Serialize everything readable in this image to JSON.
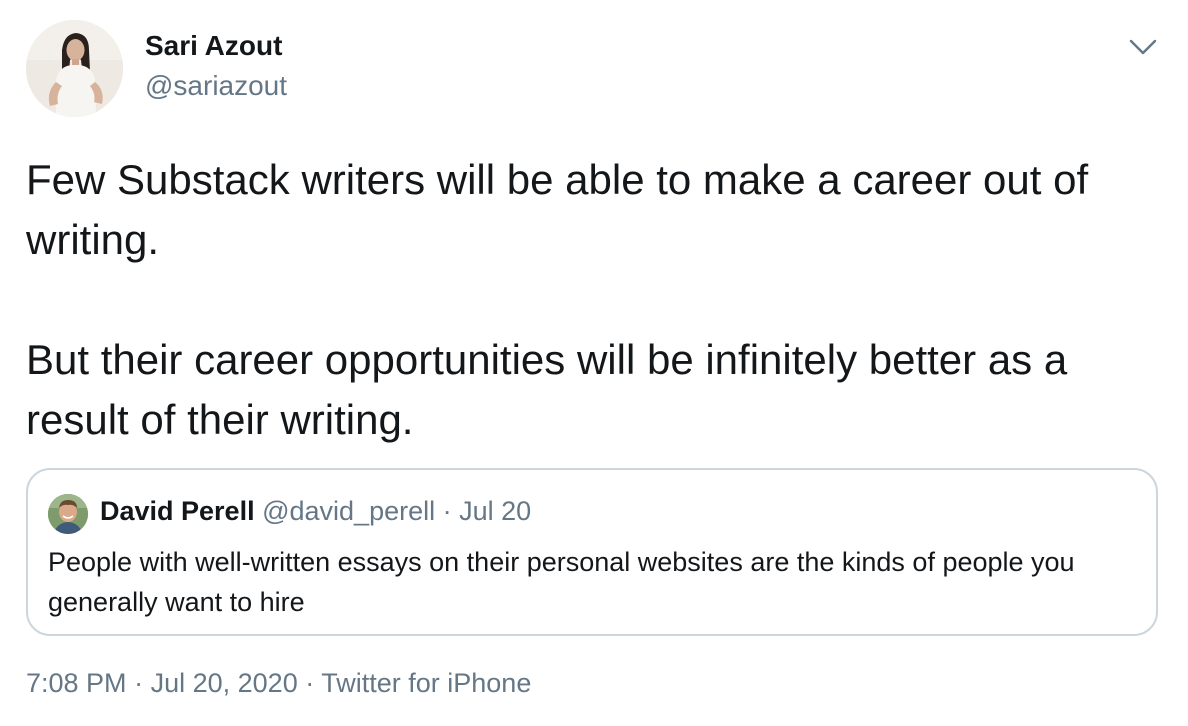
{
  "tweet": {
    "author": {
      "name": "Sari Azout",
      "handle": "@sariazout"
    },
    "menu_icon": "chevron-down-icon",
    "paragraphs": [
      "Few Substack writers will be able to make a career out of writing.",
      "But their career opportunities will be infinitely better as a result of their writing."
    ],
    "quoted": {
      "name": "David Perell",
      "handle": "@david_perell",
      "separator": "·",
      "date": "Jul 20",
      "text": "People with well-written essays on their personal websites are the kinds of people you generally want to hire"
    },
    "meta": {
      "time": "7:08 PM",
      "separator": "·",
      "date": "Jul 20, 2020",
      "source": "Twitter for iPhone"
    }
  },
  "colors": {
    "text": "#14171a",
    "secondary": "#657786",
    "border": "#ccd6dd",
    "background": "#ffffff"
  }
}
